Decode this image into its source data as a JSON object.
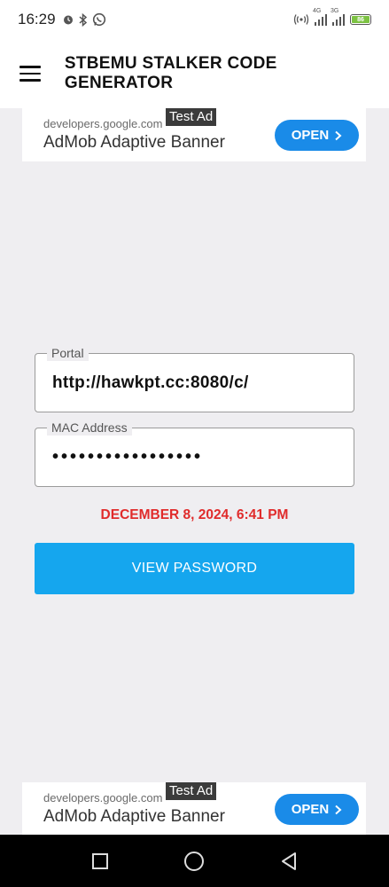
{
  "status_bar": {
    "time": "16:29",
    "network_label_1": "4G",
    "network_label_2": "3G",
    "battery_level": "86",
    "icons": [
      "alarm-icon",
      "bluetooth-icon",
      "whatsapp-icon",
      "hotspot-icon",
      "signal-icon",
      "battery-icon"
    ]
  },
  "app_bar": {
    "title": "STBEMU STALKER CODE GENERATOR",
    "menu_icon": "hamburger-menu-icon"
  },
  "ad_top": {
    "label": "Test Ad",
    "domain": "developers.google.com",
    "name": "AdMob Adaptive Banner",
    "button_label": "OPEN"
  },
  "form": {
    "portal": {
      "label": "Portal",
      "value": "http://hawkpt.cc:8080/c/"
    },
    "mac": {
      "label": "MAC Address",
      "value": "•••••••••••••••••"
    }
  },
  "date_text": "DECEMBER 8, 2024, 6:41 PM",
  "view_button": {
    "label": "VIEW PASSWORD"
  },
  "ad_bottom": {
    "label": "Test Ad",
    "domain": "developers.google.com",
    "name": "AdMob Adaptive Banner",
    "button_label": "OPEN"
  },
  "nav_bar": {
    "icons": [
      "recents-square-icon",
      "home-circle-icon",
      "back-triangle-icon"
    ]
  },
  "colors": {
    "accent": "#15a6ee",
    "ad_button": "#1a8be8",
    "date_red": "#e02b2b",
    "background": "#efeef1"
  }
}
